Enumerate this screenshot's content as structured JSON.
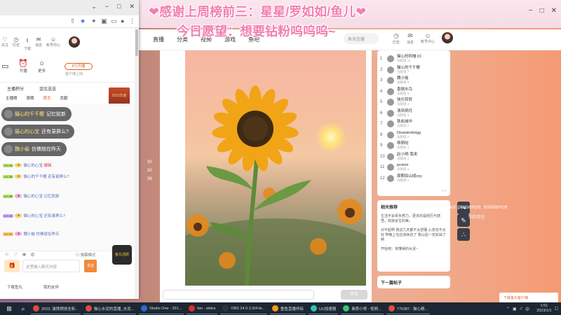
{
  "overlay": {
    "line1": "❤感谢上周榜前三：星星/罗如如/鱼儿❤",
    "line2": "今日愿望：想要钻粉呜呜呜~"
  },
  "background_window": {
    "nav": [
      "直播",
      "分类",
      "视频",
      "游戏",
      "鱼吧"
    ],
    "search_placeholder": "鱼池宝藏",
    "header_icons": [
      "历史",
      "消息",
      "帐号中心"
    ],
    "side_numbers": [
      "30",
      "30",
      "38"
    ],
    "comment_button": "评论",
    "ranking": [
      {
        "rank": "1",
        "name": "猫心的阿喵.01",
        "sub": "贡献值 11"
      },
      {
        "rank": "2",
        "name": "猫心的千千樱",
        "sub": "贡献值 7"
      },
      {
        "rank": "3",
        "name": "魏小偷",
        "sub": "贡献值 6"
      },
      {
        "rank": "4",
        "name": "香翘水鸟",
        "sub": "贡献值 5"
      },
      {
        "rank": "5",
        "name": "快乐转转",
        "sub": "贡献值 3"
      },
      {
        "rank": "6",
        "name": "清风明月",
        "sub": "贡献值 3"
      },
      {
        "rank": "7",
        "name": "铁血减中",
        "sub": "贡献值 2"
      },
      {
        "rank": "8",
        "name": "Disasterdotgg",
        "sub": "贡献值 2"
      },
      {
        "rank": "9",
        "name": "萌萌哒",
        "sub": "贡献值 1"
      },
      {
        "rank": "10",
        "name": "赵小明·我来",
        "sub": "贡献值 1"
      },
      {
        "rank": "11",
        "name": "proism",
        "sub": "贡献值 1"
      },
      {
        "rank": "12",
        "name": "周期如山成xyy",
        "sub": "贡献值 1"
      }
    ],
    "rec_title": "相关推荐",
    "rec_paras": [
      "生活不会辜负努力，更多的是经历与感悟，收获余生的美。",
      "对不起啊 我这几天都不太舒服 心态也不太好 昨晚上也应该休息了 我以后一定加油了啊",
      "开始吧：将懂得的水泥~"
    ],
    "next_label": "下一篇帖子",
    "presence_line1": "Your presence, existence",
    "presence_line2": "你的存在",
    "download_tip": "下载鱼丸客户端"
  },
  "front_window": {
    "top_icons": [
      "关注",
      "历史",
      "下载",
      "消息",
      "帐号中心"
    ],
    "row2": [
      "开播",
      "更多"
    ],
    "pc_pill": "PC开播",
    "pc_sub": "客户端上线",
    "tabs1": [
      "主播积分",
      "金比送送"
    ],
    "tabs2": [
      "主播榜",
      "周榜",
      "首页",
      "贡献"
    ],
    "poster": "2022年度",
    "bubbles": [
      {
        "name": "猫心的千千樱",
        "text": "记忆犹新"
      },
      {
        "name": "猫心的心宝",
        "text": "还有录屏么?"
      },
      {
        "name": "魏小偷",
        "text": "仿佛就在昨天"
      }
    ],
    "chat": [
      {
        "lv": "LV 44",
        "name": "猫心的心宝",
        "text": "编辑"
      },
      {
        "lv": "LV 45",
        "name": "猫心的千千樱",
        "text": "还有录屏么?"
      },
      {
        "lv": "LV 48",
        "name": "猫心的心宝",
        "text": "记忆犹新"
      },
      {
        "lv": "LV 42",
        "name": "猫心的心宝",
        "text": "还有录屏么?"
      },
      {
        "lv": "LV 42",
        "name": "魏小偷",
        "text": "仿佛就在昨天"
      }
    ],
    "chat_input_placeholder": "这里输入聊天内容",
    "send_label": "发送",
    "check_label": "弹幕模式",
    "mascot": "鱼丸活跃",
    "footer": [
      "下载鱼丸",
      "我的友伴"
    ]
  },
  "taskbar": {
    "items": [
      {
        "label": "2023, 激情燃烧全新...",
        "color": "#e14b3b"
      },
      {
        "label": "猫心水泥的直播_水泥...",
        "color": "#e14b3b"
      },
      {
        "label": "Studio One - 201...",
        "color": "#2a6bd8"
      },
      {
        "label": "fan - sletra",
        "color": "#d8322a"
      },
      {
        "label": "OBS 24.0.3 (64-bi...",
        "color": "#333333"
      },
      {
        "label": "重鱼直播伴侣",
        "color": "#f39c12"
      },
      {
        "label": "UU加速器",
        "color": "#2ec4b6"
      },
      {
        "label": "素质小哥 - 视频...",
        "color": "#2ecc71"
      },
      {
        "label": "775387 - 猫心精...",
        "color": "#e74c3c"
      }
    ],
    "time": "1:51",
    "date": "2023/1/1"
  },
  "colors": {
    "accent_orange": "#e2621b",
    "overlay_pink": "#f37fb0",
    "taskbar_bg": "#1c2733"
  }
}
